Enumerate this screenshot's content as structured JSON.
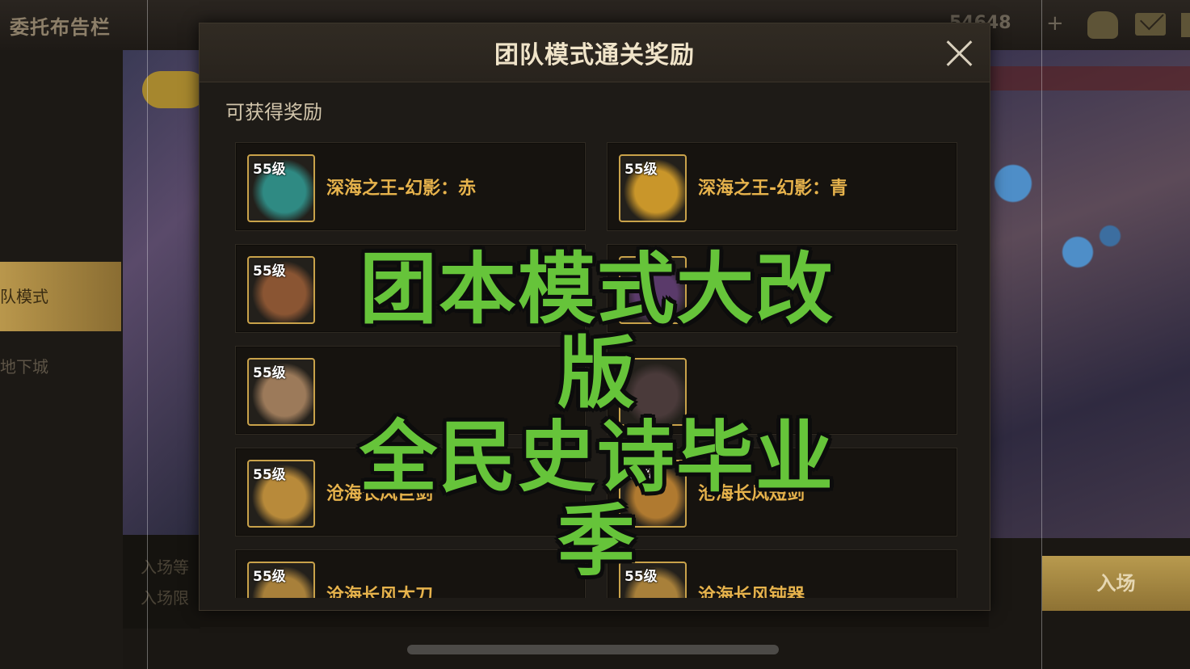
{
  "topbar": {
    "title": "委托布告栏",
    "currency": "54648",
    "plus": "+"
  },
  "sidebar": {
    "items": [
      "",
      "",
      "",
      "队模式",
      "地下城",
      ""
    ]
  },
  "left_info": {
    "line1": "入场等",
    "line2": "入场限"
  },
  "enter_button": {
    "label": "入场"
  },
  "modal": {
    "title": "团队模式通关奖励",
    "section_label": "可获得奖励",
    "rewards": [
      {
        "level": "55级",
        "name": "深海之王-幻影：赤",
        "icon": "cyan-orb-weapon-icon",
        "color": "#2f8a83"
      },
      {
        "level": "55级",
        "name": "深海之王-幻影：青",
        "icon": "golden-flare-weapon-icon",
        "color": "#c9962a"
      },
      {
        "level": "55级",
        "name": "",
        "icon": "spiked-ring-icon",
        "color": "#8a5533"
      },
      {
        "level": "",
        "name": "",
        "icon": "purple-item-icon",
        "color": "#5a3a6a"
      },
      {
        "level": "55级",
        "name": "",
        "icon": "fang-jaw-icon",
        "color": "#9c7a5a"
      },
      {
        "level": "",
        "name": "",
        "icon": "dark-item-icon",
        "color": "#4a3a3a"
      },
      {
        "level": "55级",
        "name": "沧海长风巨剑",
        "icon": "greatsword-icon",
        "color": "#b88a3a"
      },
      {
        "level": "55级",
        "name": "沧海长风短剑",
        "icon": "shortsword-icon",
        "color": "#b07a30"
      },
      {
        "level": "55级",
        "name": "沧海长风太刀",
        "icon": "katana-icon",
        "color": "#a8803a"
      },
      {
        "level": "55级",
        "name": "沧海长风钝器",
        "icon": "blunt-weapon-icon",
        "color": "#a8803a"
      }
    ]
  },
  "overlay": {
    "line1": "团本模式大改版",
    "line2": "全民史诗毕业季",
    "color": "#66c43a"
  }
}
